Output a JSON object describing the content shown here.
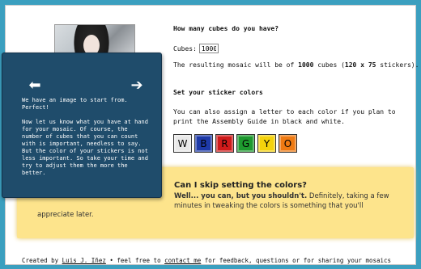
{
  "question": {
    "title": "How many cubes do you have?",
    "cubes_label": "Cubes:",
    "cubes_value": "1000",
    "mosaic_prefix": "The resulting mosaic will be of ",
    "mosaic_cubes": "1000",
    "mosaic_mid": " cubes (",
    "mosaic_dims": "120 x 75",
    "mosaic_suffix": " stickers)."
  },
  "stickers": {
    "title": "Set your sticker colors",
    "description": "You can also assign a letter to each color if you plan to print the Assembly Guide in black and white.",
    "swatches": [
      {
        "letter": "W",
        "color": "#e8e8e8"
      },
      {
        "letter": "B",
        "color": "#1e3aa8"
      },
      {
        "letter": "R",
        "color": "#cf1b1b"
      },
      {
        "letter": "G",
        "color": "#1e9a2f"
      },
      {
        "letter": "Y",
        "color": "#f4d20c"
      },
      {
        "letter": "O",
        "color": "#ef7a12"
      }
    ]
  },
  "tip": {
    "question": "Can I skip setting the colors?",
    "answer_bold": "Well... you can, but you shouldn't.",
    "answer_rest": " Definitely, taking a few minutes in tweaking the colors is something that you'll",
    "answer_end": "appreciate later."
  },
  "tooltip": {
    "prev_icon": "arrow-left-icon",
    "next_icon": "arrow-right-icon",
    "para1": "We have an image to start from. Perfect!",
    "para2": "Now let us know what you have at hand for your mosaic. Of course, the number of cubes that you can count with is important, needless to say. But the color of your stickers is not less important. So take your time and try to adjust them the more the better."
  },
  "footer": {
    "created_by": "Created by ",
    "author": "Luis J. Iñez",
    "bullet": "  •  feel free to ",
    "contact": "contact me",
    "rest": " for feedback, questions or for sharing your mosaics"
  },
  "colors": {
    "background": "#3b9fbf",
    "tooltip_bg": "#1f4c6b",
    "tip_bg": "#fde48c"
  }
}
